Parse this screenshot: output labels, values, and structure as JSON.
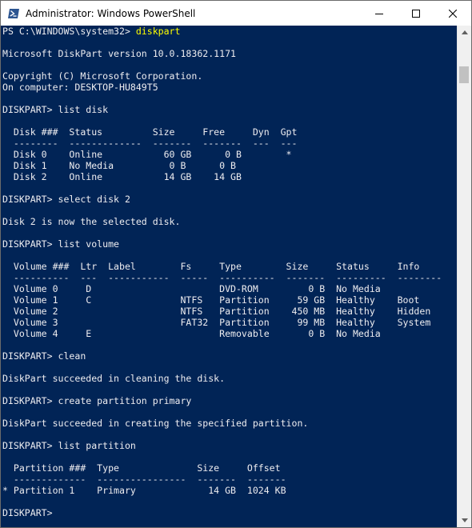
{
  "window": {
    "title": "Administrator: Windows PowerShell",
    "minimize_icon": "minimize-icon",
    "maximize_icon": "maximize-icon",
    "close_icon": "close-icon"
  },
  "colors": {
    "console_bg": "#012456",
    "console_text": "#eeedf0",
    "command_text": "#ffff00",
    "titlebar_bg": "#ffffff",
    "scrollbar_bg": "#f0f0f0",
    "scrollbar_thumb": "#c1c1c1"
  },
  "console": {
    "lines": [
      {
        "prompt": "PS C:\\WINDOWS\\system32> ",
        "command": "diskpart"
      },
      {
        "text": ""
      },
      {
        "text": "Microsoft DiskPart version 10.0.18362.1171"
      },
      {
        "text": ""
      },
      {
        "text": "Copyright (C) Microsoft Corporation."
      },
      {
        "text": "On computer: DESKTOP-HU849T5"
      },
      {
        "text": ""
      },
      {
        "text": "DISKPART> list disk"
      },
      {
        "text": ""
      },
      {
        "text": "  Disk ###  Status         Size     Free     Dyn  Gpt"
      },
      {
        "text": "  --------  -------------  -------  -------  ---  ---"
      },
      {
        "text": "  Disk 0    Online           60 GB      0 B        *"
      },
      {
        "text": "  Disk 1    No Media          0 B      0 B"
      },
      {
        "text": "  Disk 2    Online           14 GB    14 GB"
      },
      {
        "text": ""
      },
      {
        "text": "DISKPART> select disk 2"
      },
      {
        "text": ""
      },
      {
        "text": "Disk 2 is now the selected disk."
      },
      {
        "text": ""
      },
      {
        "text": "DISKPART> list volume"
      },
      {
        "text": ""
      },
      {
        "text": "  Volume ###  Ltr  Label        Fs     Type        Size     Status     Info"
      },
      {
        "text": "  ----------  ---  -----------  -----  ----------  -------  ---------  --------"
      },
      {
        "text": "  Volume 0     D                       DVD-ROM         0 B  No Media"
      },
      {
        "text": "  Volume 1     C                NTFS   Partition     59 GB  Healthy    Boot"
      },
      {
        "text": "  Volume 2                      NTFS   Partition    450 MB  Healthy    Hidden"
      },
      {
        "text": "  Volume 3                      FAT32  Partition     99 MB  Healthy    System"
      },
      {
        "text": "  Volume 4     E                       Removable       0 B  No Media"
      },
      {
        "text": ""
      },
      {
        "text": "DISKPART> clean"
      },
      {
        "text": ""
      },
      {
        "text": "DiskPart succeeded in cleaning the disk."
      },
      {
        "text": ""
      },
      {
        "text": "DISKPART> create partition primary"
      },
      {
        "text": ""
      },
      {
        "text": "DiskPart succeeded in creating the specified partition."
      },
      {
        "text": ""
      },
      {
        "text": "DISKPART> list partition"
      },
      {
        "text": ""
      },
      {
        "text": "  Partition ###  Type              Size     Offset"
      },
      {
        "text": "  -------------  ----------------  -------  -------"
      },
      {
        "text": "* Partition 1    Primary             14 GB  1024 KB"
      },
      {
        "text": ""
      },
      {
        "text": "DISKPART>"
      }
    ]
  }
}
